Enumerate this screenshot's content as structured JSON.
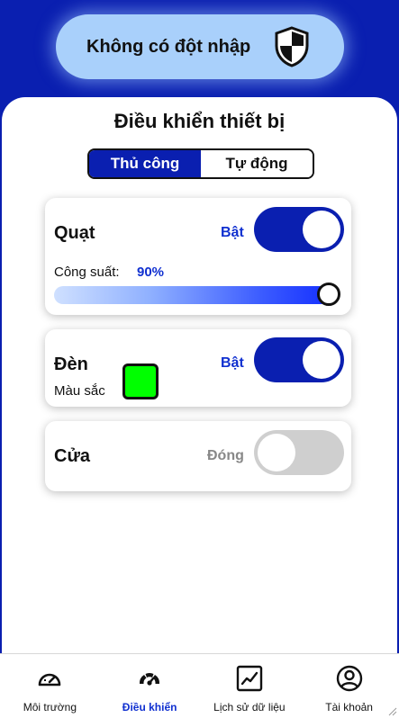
{
  "status": {
    "text": "Không có đột nhập",
    "icon": "shield-icon"
  },
  "page": {
    "title": "Điều khiển thiết bị"
  },
  "mode": {
    "options": [
      "Thủ công",
      "Tự động"
    ],
    "selected": "Thủ công"
  },
  "devices": {
    "fan": {
      "name": "Quạt",
      "state_label": "Bật",
      "on": true,
      "power_label": "Công suất:",
      "power_value": "90%",
      "power_percent": 90
    },
    "light": {
      "name": "Đèn",
      "state_label": "Bật",
      "on": true,
      "color_label": "Màu sắc",
      "color": "#00ff00"
    },
    "door": {
      "name": "Cửa",
      "state_label": "Đóng",
      "on": false
    }
  },
  "nav": {
    "items": [
      {
        "label": "Môi trường",
        "icon": "gauge-icon",
        "active": false
      },
      {
        "label": "Điều khiển",
        "icon": "control-gauge-icon",
        "active": true
      },
      {
        "label": "Lịch sử dữ liệu",
        "icon": "chart-icon",
        "active": false
      },
      {
        "label": "Tài khoản",
        "icon": "account-icon",
        "active": false
      }
    ]
  },
  "colors": {
    "primary": "#0a1fb0",
    "accent_text": "#1030d0",
    "status_bg": "#a9d0fb"
  }
}
